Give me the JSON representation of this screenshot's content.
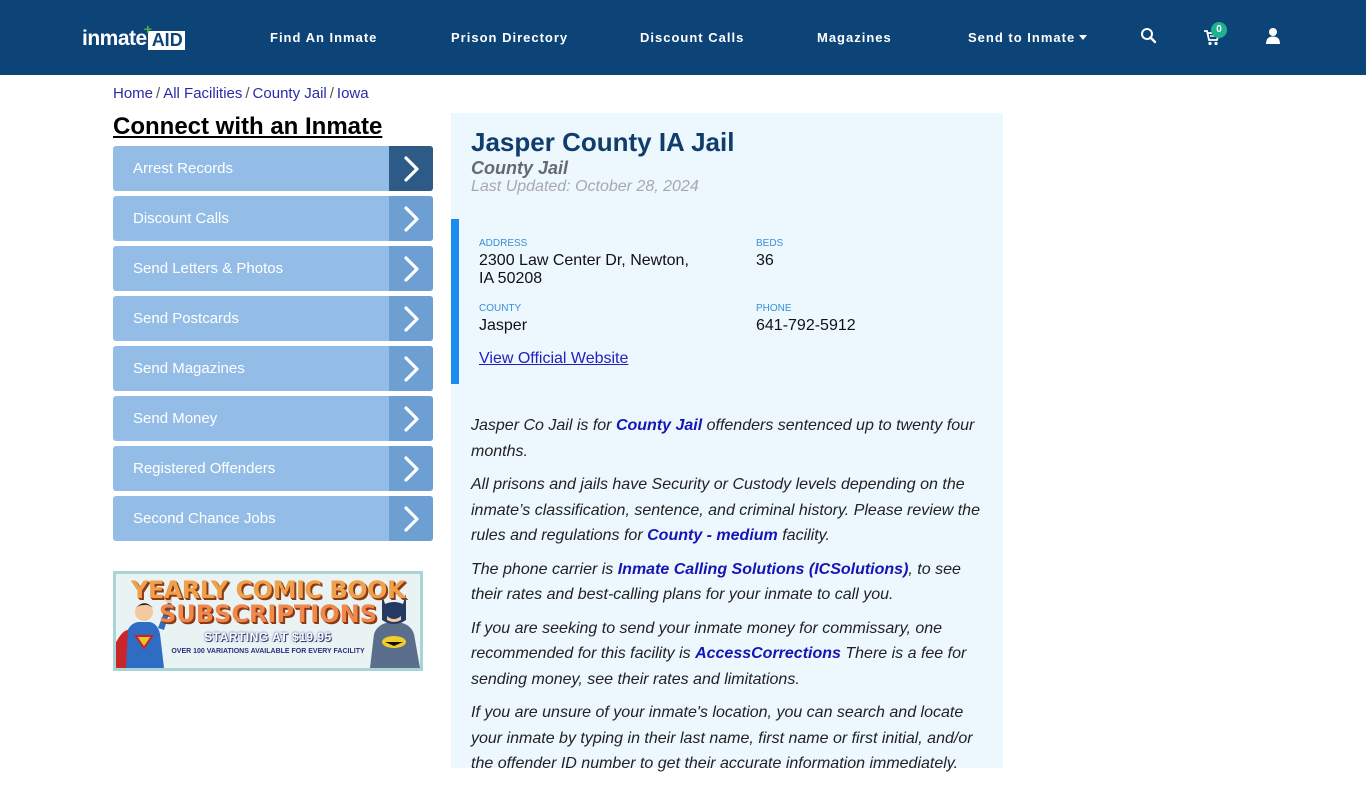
{
  "header": {
    "logo": {
      "text": "inmate",
      "accent": "AID",
      "plus": "+"
    },
    "nav": [
      {
        "label": "Find An Inmate"
      },
      {
        "label": "Prison Directory"
      },
      {
        "label": "Discount Calls"
      },
      {
        "label": "Magazines"
      },
      {
        "label": "Send to Inmate",
        "has_dropdown": true
      }
    ],
    "icons": {
      "search": "search-icon",
      "cart": "cart-icon",
      "user": "user-icon"
    },
    "cart_count": "0",
    "colors": {
      "bar": "#0c4477",
      "badge": "#1fb28f"
    }
  },
  "breadcrumb": {
    "items": [
      "Home",
      "All Facilities",
      "County Jail",
      "Iowa"
    ],
    "separator": "/"
  },
  "sidebar": {
    "title": "Connect with an Inmate",
    "items": [
      {
        "label": "Arrest Records"
      },
      {
        "label": "Discount Calls"
      },
      {
        "label": "Send Letters & Photos"
      },
      {
        "label": "Send Postcards"
      },
      {
        "label": "Send Magazines"
      },
      {
        "label": "Send Money"
      },
      {
        "label": "Registered Offenders"
      },
      {
        "label": "Second Chance Jobs"
      }
    ],
    "ad": {
      "line1": "YEARLY COMIC BOOK",
      "line2": "SUBSCRIPTIONS",
      "line3": "STARTING AT $19.95",
      "line4": "OVER 100 VARIATIONS AVAILABLE FOR EVERY FACILITY"
    }
  },
  "facility": {
    "name": "Jasper County IA Jail",
    "type": "County Jail",
    "last_updated": "Last Updated: October 28, 2024",
    "info": {
      "address_label": "ADDRESS",
      "address_line1": "2300 Law Center Dr, Newton,",
      "address_line2": "IA 50208",
      "beds_label": "BEDS",
      "beds": "36",
      "county_label": "COUNTY",
      "county": "Jasper",
      "phone_label": "PHONE",
      "phone": "641-792-5912",
      "website_link": "View Official Website"
    },
    "description": [
      {
        "before": "Jasper Co Jail is for ",
        "link": "County Jail",
        "after": " offenders sentenced up to twenty four months."
      },
      {
        "before": "All prisons and jails have Security or Custody levels depending on the inmate’s classification, sentence, and criminal history. Please review the rules and regulations for ",
        "link": "County - medium",
        "after": " facility."
      },
      {
        "before": "The phone carrier is ",
        "link": "Inmate Calling Solutions (ICSolutions)",
        "after": ", to see their rates and best-calling plans for your inmate to call you."
      },
      {
        "before": "If you are seeking to send your inmate money for commissary, one recommended for this facility is ",
        "link": "AccessCorrections",
        "after": " There is a fee for sending money, see their rates and limitations."
      },
      {
        "before": "If you are unsure of your inmate's location, you can search and locate your inmate by typing in their last name, first name or first initial, and/or the offender ID number to get their accurate information immediately.",
        "link": "",
        "after": ""
      }
    ]
  }
}
